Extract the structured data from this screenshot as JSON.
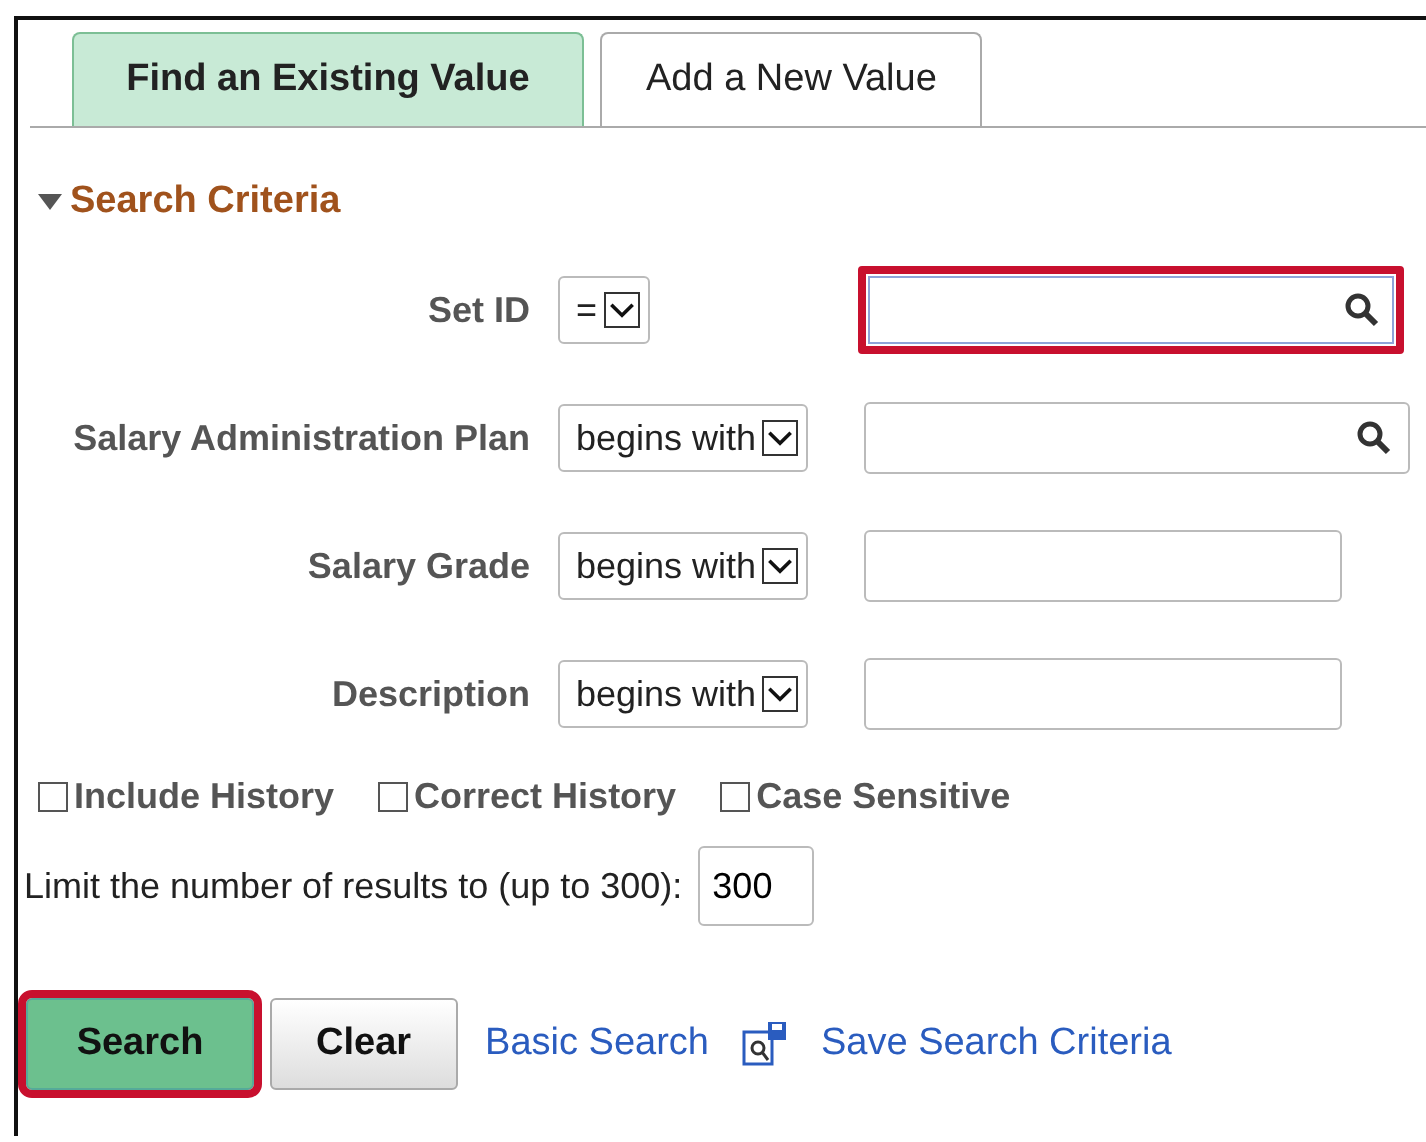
{
  "tabs": [
    {
      "label": "Find an Existing Value",
      "selected": true
    },
    {
      "label": "Add a New Value",
      "selected": false
    }
  ],
  "section": {
    "title": "Search Criteria",
    "expanded": true
  },
  "criteria": [
    {
      "label": "Set ID",
      "operator": "=",
      "lookup": true,
      "highlighted": true,
      "wide": true
    },
    {
      "label": "Salary Administration Plan",
      "operator": "begins with",
      "lookup": true,
      "highlighted": false,
      "wide": true
    },
    {
      "label": "Salary Grade",
      "operator": "begins with",
      "lookup": false,
      "highlighted": false,
      "wide": false
    },
    {
      "label": "Description",
      "operator": "begins with",
      "lookup": false,
      "highlighted": false,
      "wide": false
    }
  ],
  "options": [
    {
      "label": "Include History",
      "checked": false
    },
    {
      "label": "Correct History",
      "checked": false
    },
    {
      "label": "Case Sensitive",
      "checked": false
    }
  ],
  "limit": {
    "label": "Limit the number of results to (up to 300):",
    "value": "300"
  },
  "actions": [
    {
      "kind": "primary",
      "label": "Search",
      "highlighted": true
    },
    {
      "kind": "button",
      "label": "Clear",
      "highlighted": false
    },
    {
      "kind": "link",
      "label": "Basic Search",
      "highlighted": false
    },
    {
      "kind": "icon-link",
      "label": "Save Search Criteria",
      "highlighted": false
    }
  ]
}
